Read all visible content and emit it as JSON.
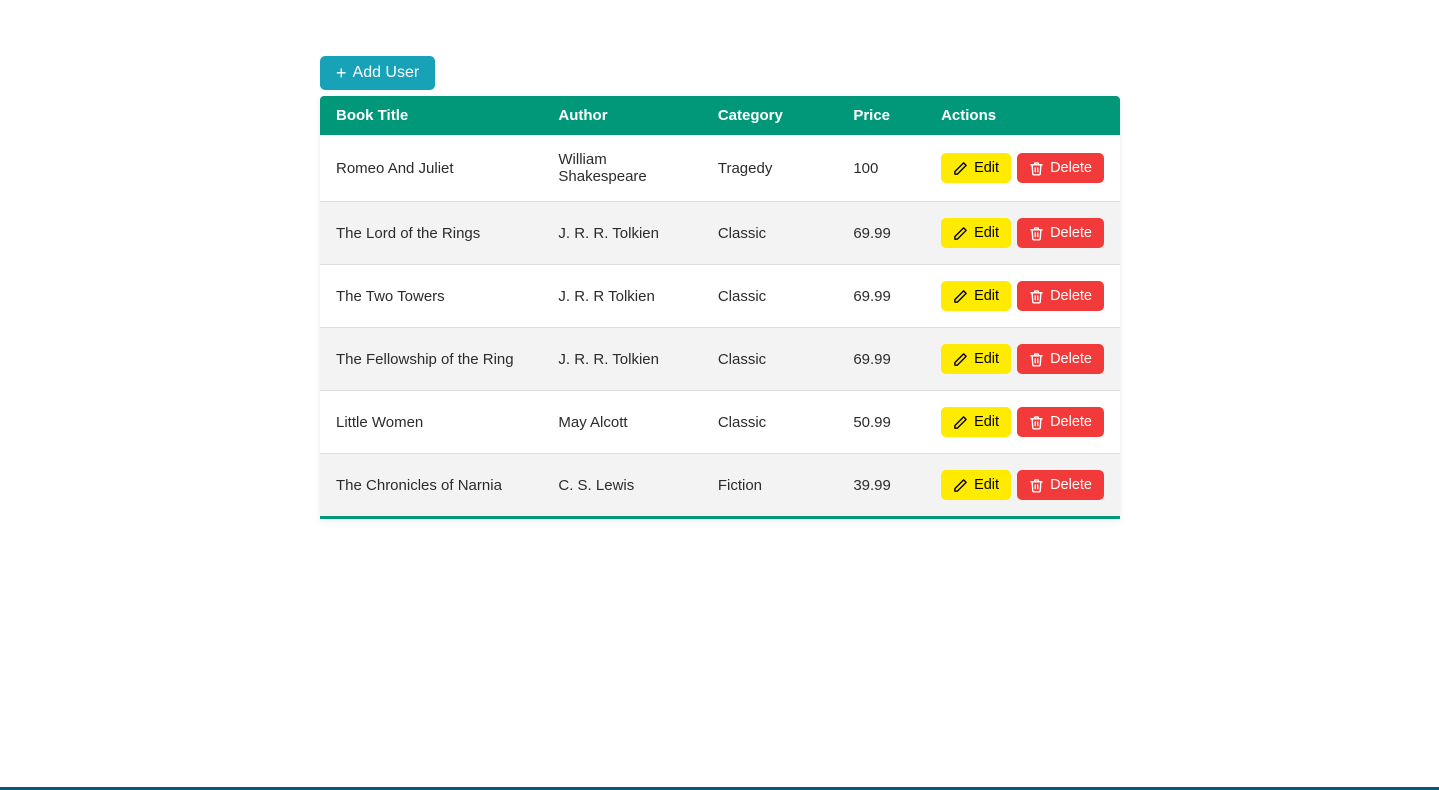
{
  "toolbar": {
    "add_label": "Add User"
  },
  "table": {
    "headers": {
      "title": "Book Title",
      "author": "Author",
      "category": "Category",
      "price": "Price",
      "actions": "Actions"
    },
    "edit_label": "Edit",
    "delete_label": "Delete",
    "rows": [
      {
        "title": "Romeo And Juliet",
        "author": "William Shakespeare",
        "category": "Tragedy",
        "price": "100"
      },
      {
        "title": "The Lord of the Rings",
        "author": "J. R. R. Tolkien",
        "category": "Classic",
        "price": "69.99"
      },
      {
        "title": "The Two Towers",
        "author": "J. R. R Tolkien",
        "category": "Classic",
        "price": "69.99"
      },
      {
        "title": "The Fellowship of the Ring",
        "author": "J. R. R. Tolkien",
        "category": "Classic",
        "price": "69.99"
      },
      {
        "title": "Little Women",
        "author": "May Alcott",
        "category": "Classic",
        "price": "50.99"
      },
      {
        "title": "The Chronicles of Narnia",
        "author": "C. S. Lewis",
        "category": "Fiction",
        "price": "39.99"
      }
    ]
  }
}
